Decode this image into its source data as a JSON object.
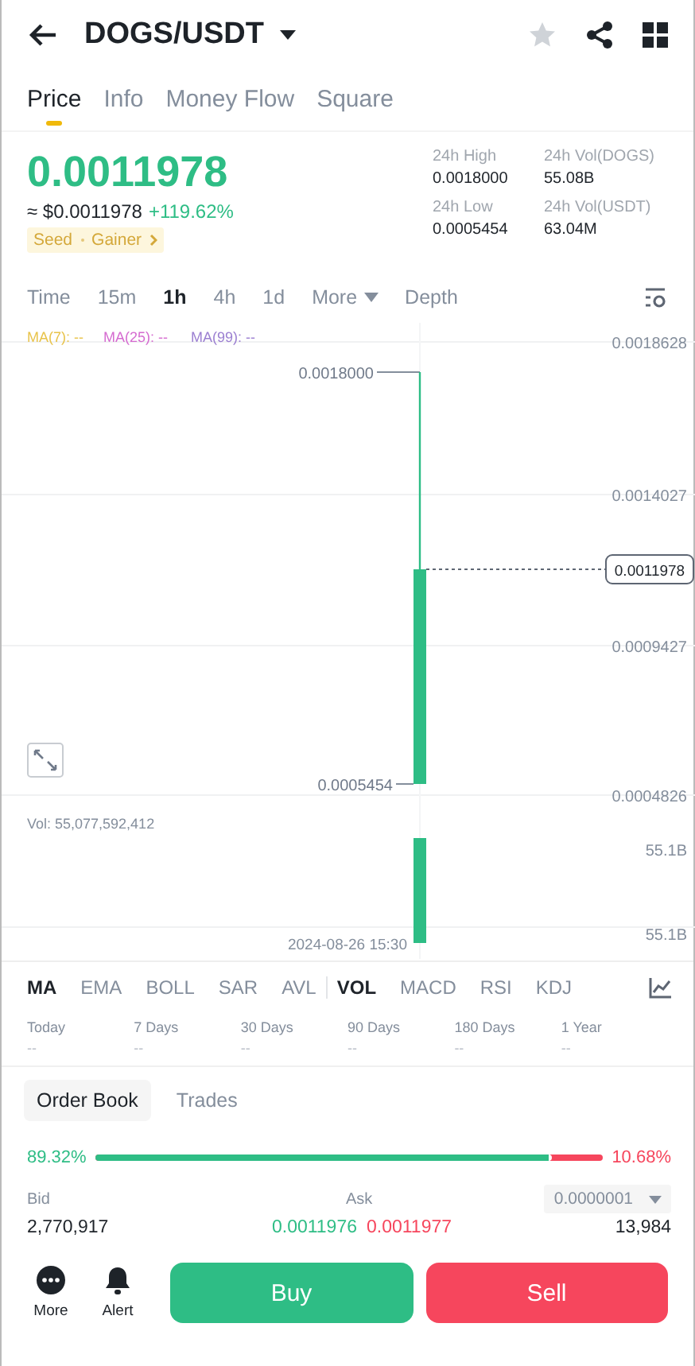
{
  "header": {
    "title": "DOGS/USDT",
    "favorite": false
  },
  "tabs": [
    {
      "label": "Price",
      "selected": true
    },
    {
      "label": "Info",
      "selected": false
    },
    {
      "label": "Money Flow",
      "selected": false
    },
    {
      "label": "Square",
      "selected": false
    }
  ],
  "price": {
    "last": "0.0011978",
    "usd": "≈ $0.0011978",
    "change": "+119.62%",
    "tags": [
      "Seed",
      "Gainer"
    ]
  },
  "stats": [
    {
      "label": "24h High",
      "value": "0.0018000"
    },
    {
      "label": "24h Vol(DOGS)",
      "value": "55.08B"
    },
    {
      "label": "24h Low",
      "value": "0.0005454"
    },
    {
      "label": "24h Vol(USDT)",
      "value": "63.04M"
    }
  ],
  "intervals": [
    {
      "label": "Time",
      "selected": false,
      "kind": "text"
    },
    {
      "label": "15m",
      "selected": false,
      "kind": "text"
    },
    {
      "label": "1h",
      "selected": true,
      "kind": "text"
    },
    {
      "label": "4h",
      "selected": false,
      "kind": "text"
    },
    {
      "label": "1d",
      "selected": false,
      "kind": "text"
    },
    {
      "label": "More",
      "selected": false,
      "kind": "dropdown"
    },
    {
      "label": "Depth",
      "selected": false,
      "kind": "text"
    }
  ],
  "chart": {
    "ma_legend": [
      {
        "label": "MA(7): --",
        "color": "#e8c34a"
      },
      {
        "label": "MA(25): --",
        "color": "#d56bd0"
      },
      {
        "label": "MA(99): --",
        "color": "#9b7fd1"
      }
    ],
    "price_axis": [
      "0.0018628",
      "0.0014027",
      "0.0009427",
      "0.0004826"
    ],
    "last_price": "0.0011978",
    "high": "0.0018000",
    "low": "0.0005454",
    "volume": "Vol: 55,077,592,412",
    "volume_axis": [
      "55.1B",
      "55.1B"
    ],
    "time": "2024-08-26 15:30"
  },
  "indicators": {
    "main": [
      {
        "label": "MA",
        "selected": true
      },
      {
        "label": "EMA",
        "selected": false
      },
      {
        "label": "BOLL",
        "selected": false
      },
      {
        "label": "SAR",
        "selected": false
      },
      {
        "label": "AVL",
        "selected": false
      }
    ],
    "sub": [
      {
        "label": "VOL",
        "selected": true
      },
      {
        "label": "MACD",
        "selected": false
      },
      {
        "label": "RSI",
        "selected": false
      },
      {
        "label": "KDJ",
        "selected": false
      }
    ]
  },
  "periods": [
    {
      "label": "Today",
      "value": "--"
    },
    {
      "label": "7 Days",
      "value": "--"
    },
    {
      "label": "30 Days",
      "value": "--"
    },
    {
      "label": "90 Days",
      "value": "--"
    },
    {
      "label": "180 Days",
      "value": "--"
    },
    {
      "label": "1 Year",
      "value": "--"
    }
  ],
  "book_tabs": [
    {
      "label": "Order Book",
      "selected": true
    },
    {
      "label": "Trades",
      "selected": false
    }
  ],
  "ratio": {
    "bid": "89.32%",
    "ask": "10.68%",
    "level": 0.8932
  },
  "book": {
    "bid_label": "Bid",
    "ask_label": "Ask",
    "precision": "0.0000001",
    "bid_qty": "2,770,917",
    "bid_price": "0.0011976",
    "ask_price": "0.0011977",
    "ask_qty": "13,984"
  },
  "bottom": {
    "actions": [
      {
        "label": "More",
        "kind": "more"
      },
      {
        "label": "Alert",
        "kind": "alert"
      }
    ],
    "buy": "Buy",
    "sell": "Sell"
  }
}
